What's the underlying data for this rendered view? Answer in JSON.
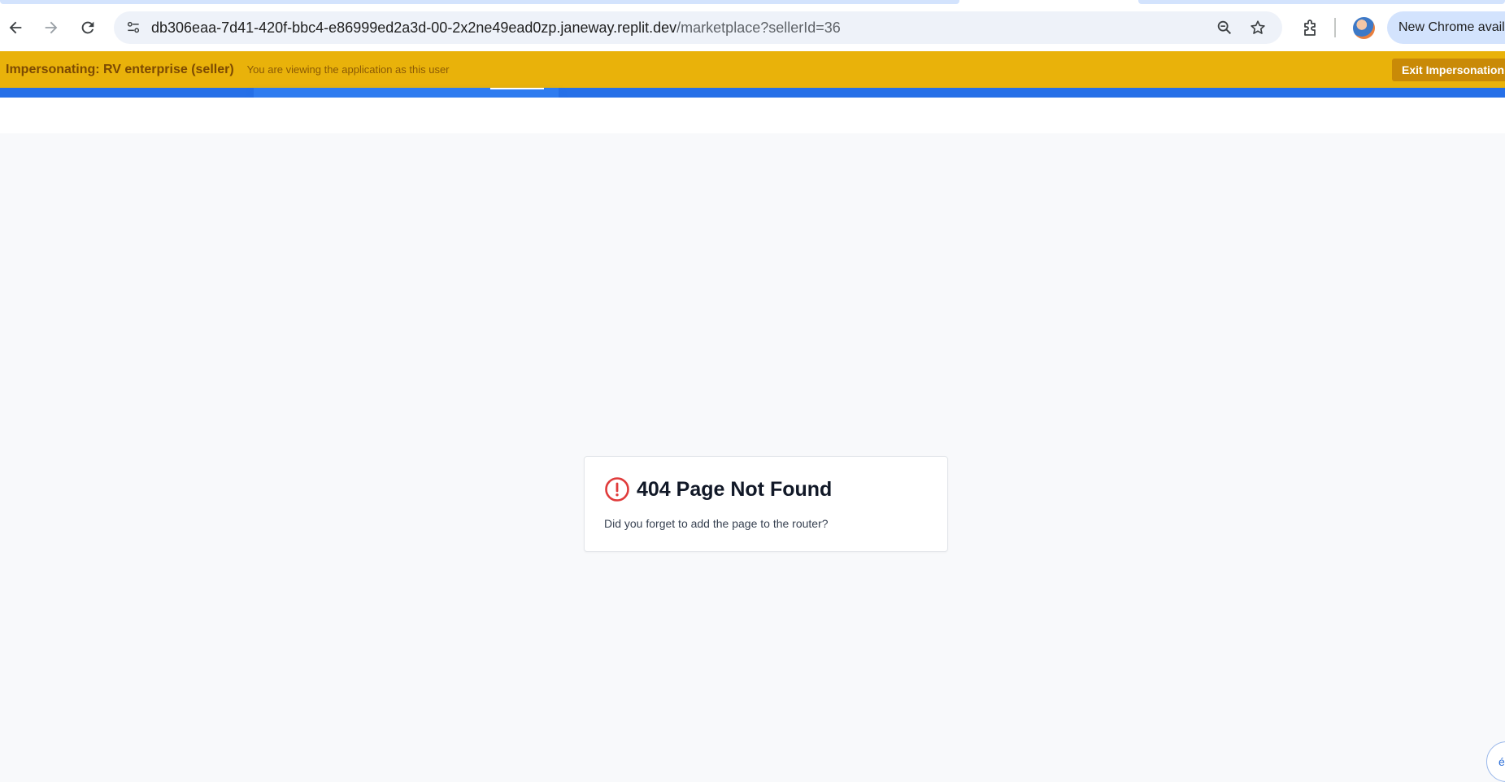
{
  "browser": {
    "url_host": "db306eaa-7d41-420f-bbc4-e86999ed2a3d-00-2x2ne49ead0zp.janeway.replit.dev",
    "url_path": "/marketplace?sellerId=36",
    "new_chrome_label": "New Chrome availab",
    "icons": {
      "back": "back-arrow-icon",
      "forward": "forward-arrow-icon",
      "reload": "reload-icon",
      "site_info": "site-info-icon",
      "zoom": "zoom-out-icon",
      "bookmark": "star-icon",
      "extensions": "puzzle-icon"
    }
  },
  "impersonation": {
    "title": "Impersonating: RV enterprise (seller)",
    "subtitle": "You are viewing the application as this user",
    "exit_label": "Exit Impersonation",
    "color": "#e9b20a"
  },
  "error": {
    "title": "404 Page Not Found",
    "message": "Did you forget to add the page to the router?",
    "icon": "alert-circle-icon",
    "icon_color": "#e03b3b"
  },
  "corner_widget": {
    "label": "é"
  },
  "colors": {
    "header_blue": "#2670e8",
    "page_bg": "#f8f9fb"
  }
}
